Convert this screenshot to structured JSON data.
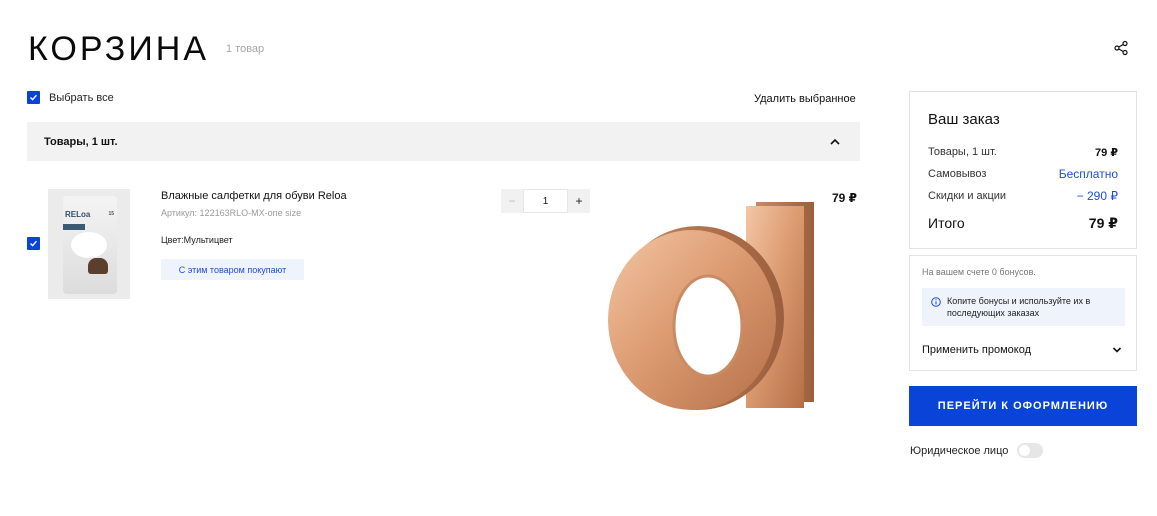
{
  "header": {
    "title": "КОРЗИНА",
    "count": "1 товар",
    "share_icon": "share-icon"
  },
  "toolbar": {
    "select_all": "Выбрать все",
    "delete_selected": "Удалить выбранное"
  },
  "group": {
    "title": "Товары, 1 шт.",
    "chevron_icon": "chevron-up-icon"
  },
  "item": {
    "checked": true,
    "image_brand": "RELoa",
    "image_count": "15",
    "name": "Влажные салфетки для обуви Reloa",
    "article": "Артикул: 122163RLO-MX-one size",
    "color": "Цвет:Мультицвет",
    "related_button": "С этим товаром покупают",
    "quantity": "1",
    "minus": "−",
    "plus": "+",
    "price": "79 ₽"
  },
  "summary": {
    "title": "Ваш заказ",
    "goods_label": "Товары, 1 шт.",
    "goods_value": "79 ₽",
    "pickup_label": "Самовывоз",
    "pickup_value": "Бесплатно",
    "discounts_label": "Скидки и акции",
    "discounts_value": "− 290 ₽",
    "total_label": "Итого",
    "total_value": "79 ₽"
  },
  "bonus": {
    "balance": "На вашем счете 0 бонусов.",
    "info": "Копите бонусы и используйте их в последующих заказах",
    "promo": "Применить промокод"
  },
  "checkout_button": "ПЕРЕЙТИ К ОФОРМЛЕНИЮ",
  "legal": {
    "label": "Юридическое лицо",
    "enabled": false
  },
  "colors": {
    "accent": "#0a43d8",
    "link_blue": "#1e4fd1",
    "panel_bg": "#f2f2f2",
    "info_bg": "#eef3fc"
  }
}
